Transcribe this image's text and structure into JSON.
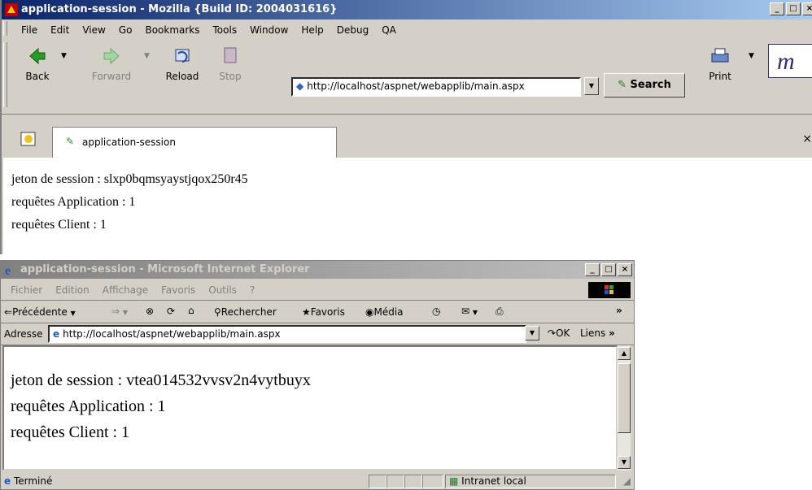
{
  "mozilla": {
    "title": "application-session - Mozilla {Build ID: 2004031616}",
    "menu": [
      "File",
      "Edit",
      "View",
      "Go",
      "Bookmarks",
      "Tools",
      "Window",
      "Help",
      "Debug",
      "QA"
    ],
    "toolbar": {
      "back": "Back",
      "forward": "Forward",
      "reload": "Reload",
      "stop": "Stop",
      "search": "Search",
      "print": "Print"
    },
    "url": "http://localhost/aspnet/webapplib/main.aspx",
    "tab_label": "application-session",
    "close_tab": "×",
    "lines": [
      "jeton de session : slxp0bqmsyaystjqox250r45",
      "requêtes Application : 1",
      "requêtes Client : 1"
    ]
  },
  "ie": {
    "title": "application-session - Microsoft Internet Explorer",
    "menu": [
      "Fichier",
      "Edition",
      "Affichage",
      "Favoris",
      "Outils",
      "?"
    ],
    "toolbar": {
      "back": "Précédente",
      "search": "Rechercher",
      "favorites": "Favoris",
      "media": "Média"
    },
    "address_label": "Adresse",
    "url": "http://localhost/aspnet/webapplib/main.aspx",
    "ok": "OK",
    "links": "Liens",
    "more": "»",
    "lines": [
      "jeton de session : vtea014532vvsv2n4vytbuyx",
      "requêtes Application : 1",
      "requêtes Client : 1"
    ],
    "status_text": "Terminé",
    "zone": "Intranet local"
  },
  "window_controls": {
    "minimize": "_",
    "maximize": "□",
    "close": "×"
  }
}
